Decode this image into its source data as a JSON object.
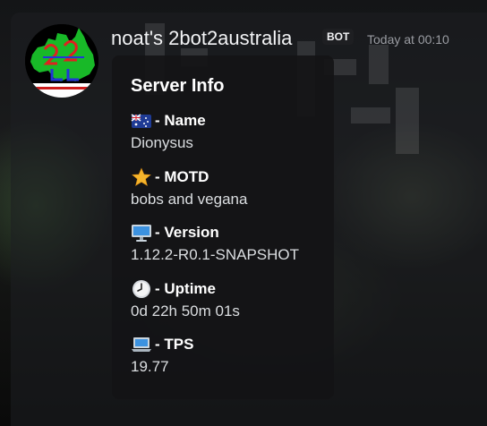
{
  "message": {
    "author": "noat's 2bot2australia",
    "bot_tag": "BOT",
    "timestamp": "Today at 00:10"
  },
  "embed": {
    "title": "Server Info",
    "fields": [
      {
        "icon": "australia-flag-icon",
        "name": "- Name",
        "value": "Dionysus"
      },
      {
        "icon": "star-icon",
        "name": "- MOTD",
        "value": "bobs and vegana"
      },
      {
        "icon": "desktop-computer-icon",
        "name": "- Version",
        "value": "1.12.2-R0.1-SNAPSHOT"
      },
      {
        "icon": "clock-icon",
        "name": "- Uptime",
        "value": "0d 22h 50m 01s"
      },
      {
        "icon": "laptop-icon",
        "name": "- TPS",
        "value": "19.77"
      }
    ]
  },
  "colors": {
    "embed_bg": "#131416",
    "text_primary": "#ffffff",
    "text_secondary": "#dbdee1",
    "timestamp": "#9a9ca2",
    "star": "#f5b52c"
  }
}
